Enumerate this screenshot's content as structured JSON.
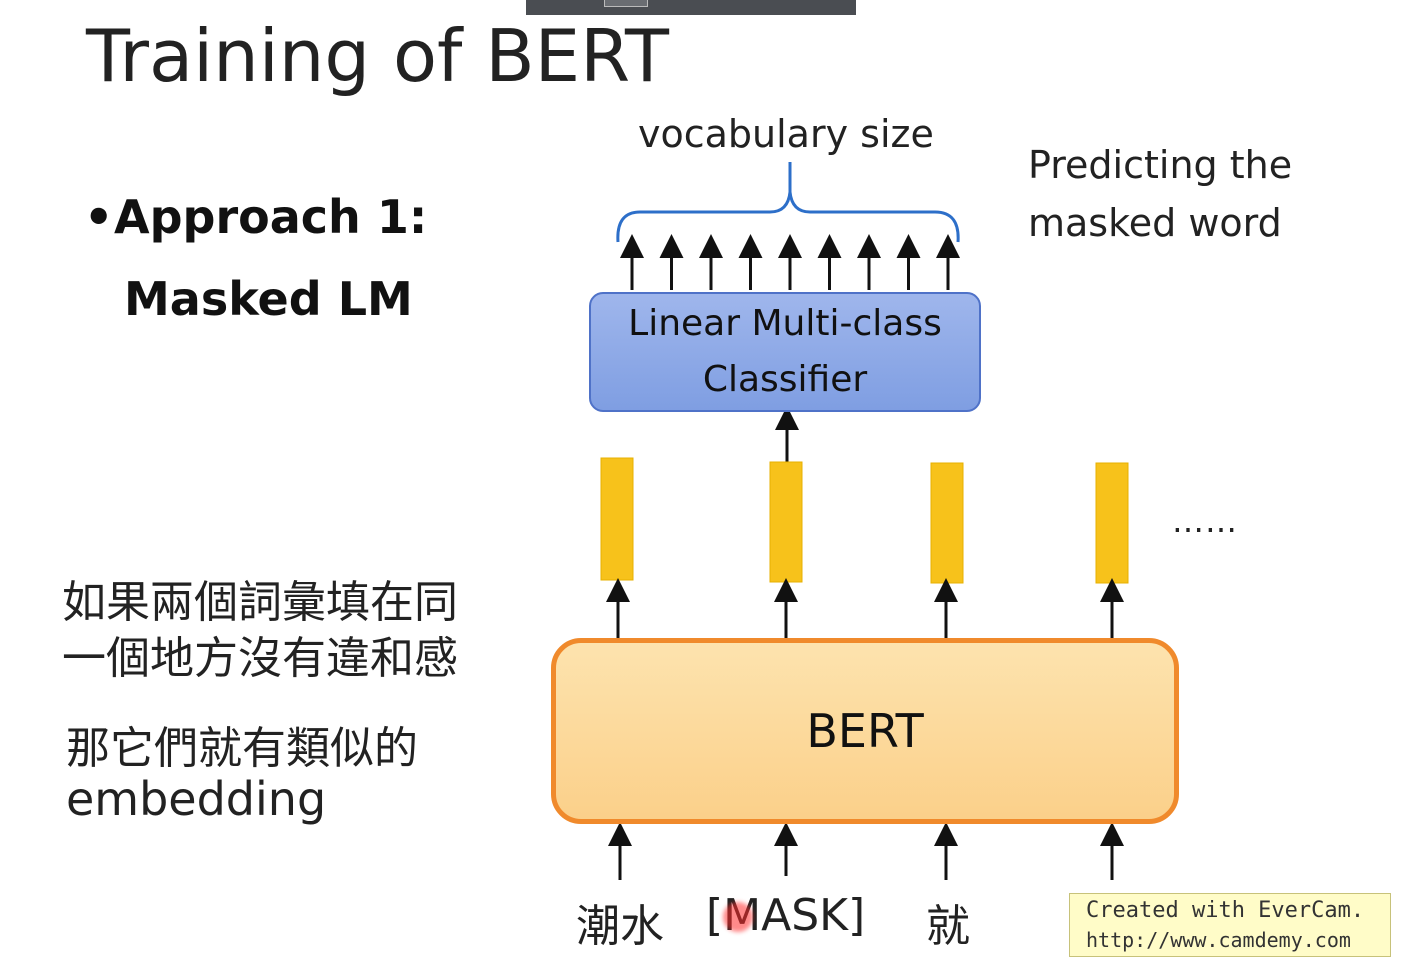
{
  "slide": {
    "title": "Training of BERT",
    "bullet_marker": "•",
    "bullet_line1": "Approach 1:",
    "bullet_line2": "Masked LM"
  },
  "notes": {
    "line1": "如果兩個詞彙填在同",
    "line2": "一個地方沒有違和感",
    "line3": "那它們就有類似的",
    "line4": "embedding"
  },
  "diagram": {
    "vocab_label": "vocabulary size",
    "predict_label": "Predicting the masked word",
    "classifier_label": "Linear Multi-class Classifier",
    "bert_label": "BERT",
    "ellipsis": "……",
    "tokens": [
      "潮水",
      "[MASK]",
      "就"
    ],
    "output_arrow_count": 9,
    "colors": {
      "classifier_fill": "#8faae8",
      "classifier_border": "#4f72c8",
      "bert_fill": "#fcd99b",
      "bert_border": "#f08a2c",
      "embedding_fill": "#f7c21b",
      "brace": "#2d6fc9"
    }
  },
  "watermark": {
    "line1": "Created with EverCam.",
    "line2": "http://www.camdemy.com"
  }
}
